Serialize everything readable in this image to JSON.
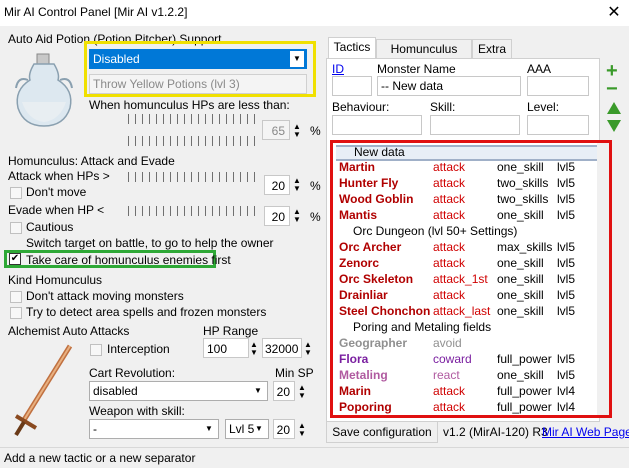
{
  "window": {
    "title": "Mir AI Control Panel [Mir AI v1.2.2]",
    "close": "✕"
  },
  "potion": {
    "group": "Auto Aid Potion (Potion Pitcher) Support",
    "mode": "Disabled",
    "type": "Throw Yellow Potions (lvl 3)",
    "hp_label": "When homunculus HPs are less than:",
    "hp_value": "65",
    "unit": "%"
  },
  "attack": {
    "group": "Homunculus: Attack and Evade",
    "attack_when": "Attack when HPs >",
    "attack_value": "20",
    "dont_move": "Don't move",
    "evade_when": "Evade when HP <",
    "evade_value": "20",
    "cautious": "Cautious",
    "switch_target": "Switch target on battle, to go to help the owner",
    "take_care": "Take care of homunculus enemies first",
    "unit": "%"
  },
  "kind": {
    "group": "Kind Homunculus",
    "opt1": "Don't attack moving monsters",
    "opt2": "Try to detect area spells and frozen monsters"
  },
  "alchemist": {
    "group": "Alchemist Auto Attacks",
    "interception": "Interception",
    "hp_range": "HP Range",
    "hp_min": "100",
    "hp_max": "32000",
    "cart_rev": "Cart Revolution:",
    "cart_value": "disabled",
    "min_sp": "Min SP",
    "min_sp_value": "20",
    "weapon_skill": "Weapon with skill:",
    "weapon_value": "-",
    "lvl_value": "Lvl 5",
    "weapon_sp": "20"
  },
  "tabs": [
    "Tactics",
    "Homunculus Skills",
    "Extra"
  ],
  "tactics": {
    "id_label": "ID",
    "monster_name_label": "Monster Name",
    "aaa_label": "AAA",
    "monster_name_value": "-- New data",
    "behaviour_label": "Behaviour:",
    "skill_label": "Skill:",
    "level_label": "Level:"
  },
  "list": {
    "header": "New data",
    "rows": [
      {
        "name": "Martin",
        "beh": "attack",
        "skill": "one_skill",
        "lvl": "lvl5"
      },
      {
        "name": "Hunter Fly",
        "beh": "attack",
        "skill": "two_skills",
        "lvl": "lvl5"
      },
      {
        "name": "Wood Goblin",
        "beh": "attack",
        "skill": "two_skills",
        "lvl": "lvl5"
      },
      {
        "name": "Mantis",
        "beh": "attack",
        "skill": "one_skill",
        "lvl": "lvl5"
      }
    ],
    "sep1": "Orc Dungeon (lvl 50+ Settings)",
    "rows2": [
      {
        "name": "Orc Archer",
        "beh": "attack",
        "skill": "max_skills",
        "lvl": "lvl5"
      },
      {
        "name": "Zenorc",
        "beh": "attack",
        "skill": "one_skill",
        "lvl": "lvl5"
      },
      {
        "name": "Orc Skeleton",
        "beh": "attack_1st",
        "skill": "one_skill",
        "lvl": "lvl5"
      },
      {
        "name": "Drainliar",
        "beh": "attack",
        "skill": "one_skill",
        "lvl": "lvl5"
      },
      {
        "name": "Steel Chonchon",
        "beh": "attack_last",
        "skill": "one_skill",
        "lvl": "lvl5"
      }
    ],
    "sep2": "Poring and Metaling fields",
    "rows3": [
      {
        "name": "Geographer",
        "beh": "avoid",
        "skill": "",
        "lvl": "",
        "color": "#909090",
        "bcolor": "#909090"
      },
      {
        "name": "Flora",
        "beh": "coward",
        "skill": "full_power",
        "lvl": "lvl5",
        "color": "#7a1fa0",
        "bcolor": "#7a1fa0"
      },
      {
        "name": "Metaling",
        "beh": "react",
        "skill": "one_skill",
        "lvl": "lvl5",
        "color": "#b05aa0",
        "bcolor": "#b05aa0"
      },
      {
        "name": "Marin",
        "beh": "attack",
        "skill": "full_power",
        "lvl": "lvl4",
        "color": "#b00000",
        "bcolor": "#d00000"
      },
      {
        "name": "Poporing",
        "beh": "attack",
        "skill": "full_power",
        "lvl": "lvl4",
        "color": "#b00000",
        "bcolor": "#d00000"
      }
    ]
  },
  "footer": {
    "save": "Save configuration",
    "version": "v1.2 (MirAI-120) R3",
    "link": "Mir AI Web Page",
    "status": "Add a new tactic or a new separator"
  },
  "colors": {
    "name_red": "#b00000",
    "beh_red": "#d00000",
    "highlight_yellow": "#f0e000",
    "highlight_green": "#2ea836",
    "highlight_red": "#e01010",
    "select_blue": "#0078d7"
  }
}
